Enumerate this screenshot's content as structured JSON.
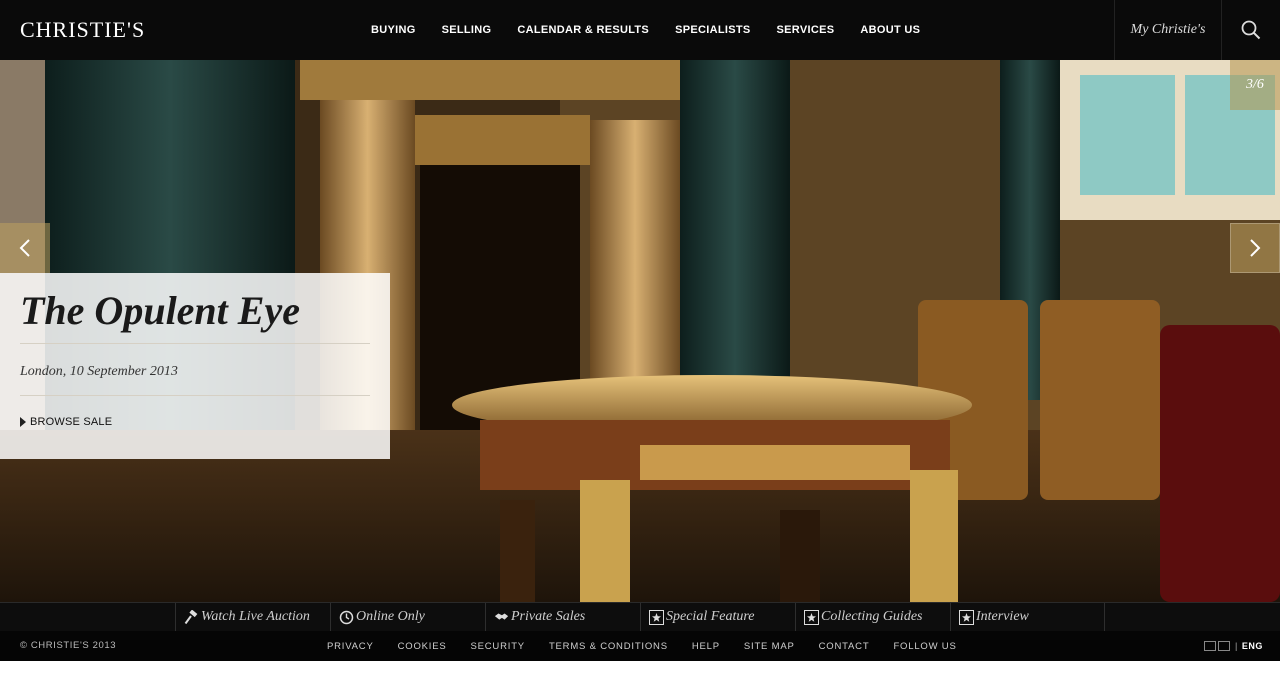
{
  "header": {
    "logo": "CHRISTIE'S",
    "nav": [
      "BUYING",
      "SELLING",
      "CALENDAR & RESULTS",
      "SPECIALISTS",
      "SERVICES",
      "ABOUT US"
    ],
    "my_account": "My Christie's"
  },
  "hero": {
    "counter": "3/6",
    "title": "The Opulent Eye",
    "subtitle": "London, 10 September 2013",
    "browse_label": "BROWSE SALE"
  },
  "categories": [
    {
      "label": "Watch Live Auction",
      "icon": "gavel-icon"
    },
    {
      "label": "Online Only",
      "icon": "clock-icon"
    },
    {
      "label": "Private Sales",
      "icon": "handshake-icon"
    },
    {
      "label": "Special Feature",
      "icon": "star-icon"
    },
    {
      "label": "Collecting Guides",
      "icon": "star-icon"
    },
    {
      "label": "Interview",
      "icon": "star-icon"
    }
  ],
  "footer": {
    "copyright": "© CHRISTIE'S 2013",
    "links": [
      "PRIVACY",
      "COOKIES",
      "SECURITY",
      "TERMS & CONDITIONS",
      "HELP",
      "SITE MAP",
      "CONTACT",
      "FOLLOW US"
    ],
    "language": "ENG"
  },
  "colors": {
    "header_bg": "#0a0a0a",
    "accent_gold": "#b4965a"
  }
}
